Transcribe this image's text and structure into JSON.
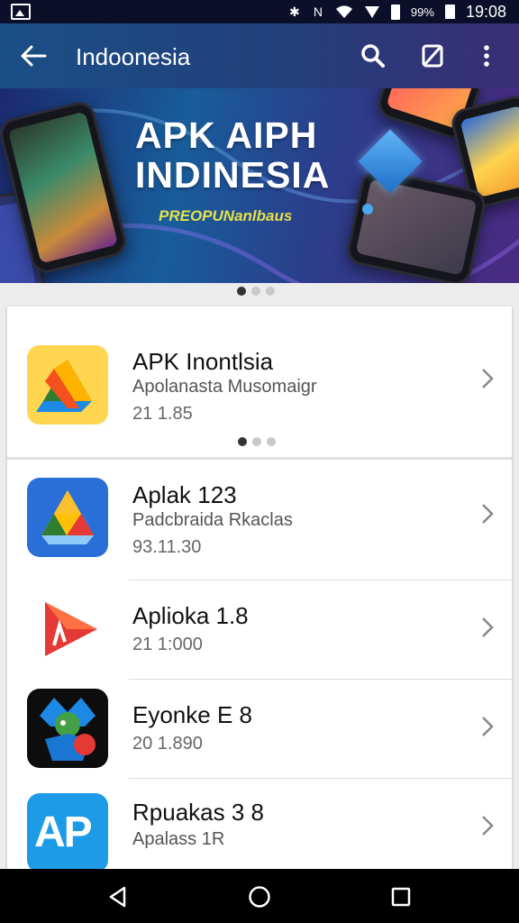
{
  "status_bar": {
    "icons": [
      "image-icon",
      "bluetooth-icon",
      "nfc-icon",
      "wifi-icon",
      "signal-icon"
    ],
    "battery_text": "99%",
    "time": "19:08"
  },
  "app_bar": {
    "title": "Indoonesia",
    "actions": [
      "search-icon",
      "rotate-icon",
      "more-vert-icon"
    ]
  },
  "banner": {
    "title_line1": "APK AIPH",
    "title_line2": "INDINESIA",
    "subtitle": "PREOPUNanlbaus",
    "page_count": 3,
    "active_page": 0
  },
  "apps": [
    {
      "name": "APK Inontlsia",
      "subtitle": "Apolanasta Musomaigr",
      "meta": "21 1.85",
      "icon": "drive-triangle-yellow"
    },
    {
      "name": "Aplak 123",
      "subtitle": "Padcbraida Rkaclas",
      "meta": "93.11.30",
      "icon": "drive-triangle-blue"
    },
    {
      "name": "Aplioka 1.8",
      "subtitle": "",
      "meta": "21 1:000",
      "icon": "red-arrow"
    },
    {
      "name": "Eyonke E 8",
      "subtitle": "",
      "meta": "20 1.890",
      "icon": "mascot"
    },
    {
      "name": "Rpuakas 3 8",
      "subtitle": "Apalass 1R",
      "meta": "",
      "icon": "ap-logo"
    }
  ],
  "card_dots": {
    "page_count": 3,
    "active_page": 0
  },
  "nav_bar": [
    "back-icon",
    "home-icon",
    "recents-icon"
  ],
  "colors": {
    "app_bar": "#233f7a",
    "banner_title": "#ffffff",
    "banner_subtitle": "#e6e04a",
    "card_bg": "#ffffff",
    "page_bg": "#ececec"
  }
}
